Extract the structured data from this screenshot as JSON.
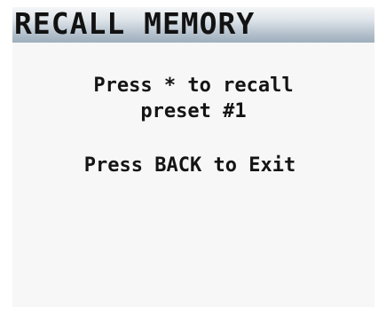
{
  "screen": {
    "title": "RECALL MEMORY",
    "instructions": {
      "line1": "Press * to recall",
      "line2": "preset #1",
      "line3": "Press BACK to Exit"
    }
  },
  "colors": {
    "background": "#f7f7f7",
    "title_gradient_top": "#f4f6f8",
    "title_gradient_bottom": "#9daebc",
    "text": "#141414"
  }
}
